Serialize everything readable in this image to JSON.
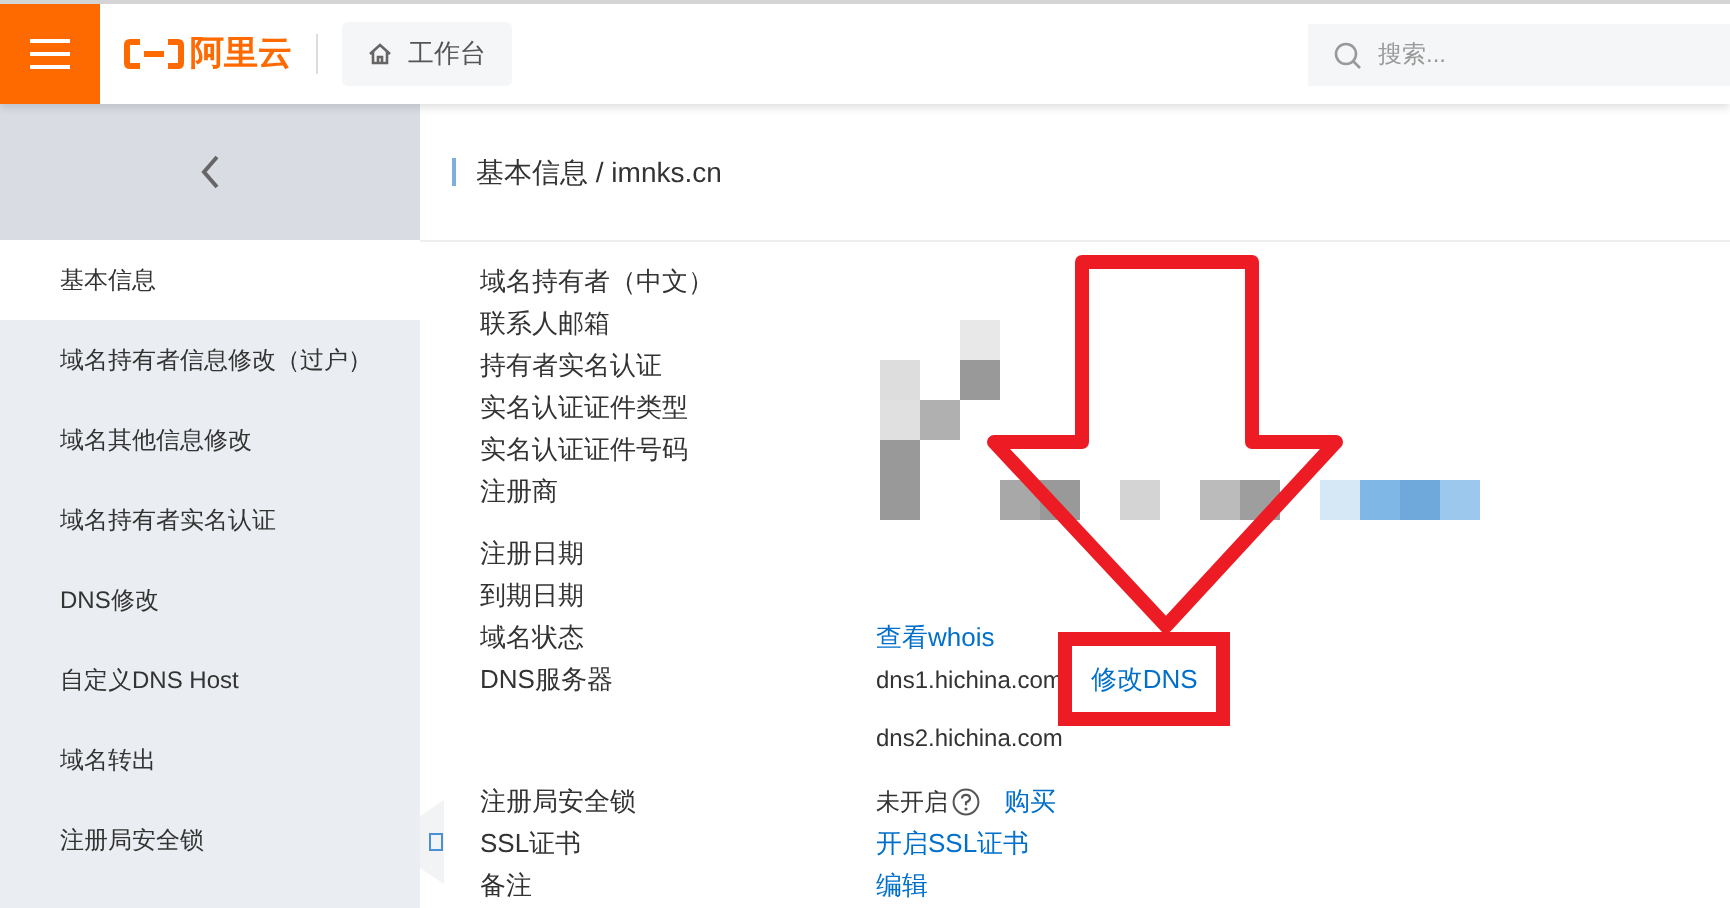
{
  "header": {
    "brand": "阿里云",
    "workbench": "工作台",
    "search": {
      "placeholder": "搜索..."
    }
  },
  "sidebar": {
    "items": [
      {
        "label": "基本信息",
        "selected": true
      },
      {
        "label": "域名持有者信息修改（过户）",
        "selected": false
      },
      {
        "label": "域名其他信息修改",
        "selected": false
      },
      {
        "label": "域名持有者实名认证",
        "selected": false
      },
      {
        "label": "DNS修改",
        "selected": false
      },
      {
        "label": "自定义DNS Host",
        "selected": false
      },
      {
        "label": "域名转出",
        "selected": false
      },
      {
        "label": "注册局安全锁",
        "selected": false
      }
    ]
  },
  "breadcrumb": "基本信息 / imnks.cn",
  "details": [
    [
      {
        "label": "域名持有者（中文）"
      },
      {
        "label": "联系人邮箱"
      },
      {
        "label": "持有者实名认证"
      },
      {
        "label": "实名认证证件类型"
      },
      {
        "label": "实名认证证件号码"
      },
      {
        "label": "注册商"
      }
    ],
    [
      {
        "label": "注册日期"
      },
      {
        "label": "到期日期"
      },
      {
        "label": "域名状态",
        "lines": [
          [
            {
              "kind": "link",
              "text": "查看whois"
            }
          ]
        ]
      },
      {
        "label": "DNS服务器",
        "lines": [
          [
            {
              "kind": "text",
              "text": "dns1.hichina.com"
            },
            {
              "kind": "link",
              "text": "修改DNS",
              "highlighted": true
            }
          ],
          [
            {
              "kind": "text",
              "text": "dns2.hichina.com"
            }
          ]
        ]
      }
    ],
    [
      {
        "label": "注册局安全锁",
        "lines": [
          [
            {
              "kind": "text",
              "text": "未开启"
            },
            {
              "kind": "help"
            },
            {
              "kind": "link",
              "text": "购买"
            }
          ]
        ]
      },
      {
        "label": "SSL证书",
        "lines": [
          [
            {
              "kind": "link",
              "text": "开启SSL证书"
            }
          ]
        ]
      },
      {
        "label": "备注",
        "lines": [
          [
            {
              "kind": "link",
              "text": "编辑"
            }
          ]
        ]
      }
    ]
  ]
}
